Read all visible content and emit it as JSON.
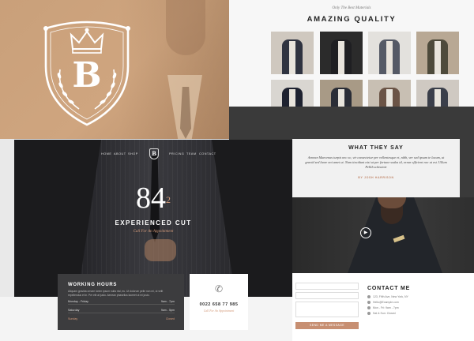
{
  "hero": {
    "logo_letter": "B",
    "crest_icon": "crown-crest-icon"
  },
  "gallery": {
    "subtitle": "Only The Best Materials",
    "title": "AMAZING QUALITY",
    "thumbs": [
      {
        "bg": "#cfc8bf",
        "suit": "#2f3340"
      },
      {
        "bg": "#2b2b2b",
        "suit": "#1f1f22"
      },
      {
        "bg": "#e3e1dd",
        "suit": "#555a66"
      },
      {
        "bg": "#b8a894",
        "suit": "#4d4a3b"
      },
      {
        "bg": "#d9d6d1",
        "suit": "#1e2230"
      },
      {
        "bg": "#a89a86",
        "suit": "#2a2d36"
      },
      {
        "bg": "#c8bfb3",
        "suit": "#6b5446"
      },
      {
        "bg": "#cfc9c2",
        "suit": "#3b3f4a"
      }
    ]
  },
  "testimonial": {
    "heading": "WHAT THEY SAY",
    "quote": "Aenean Maecenas turpis nec oc, vir consectetur per vellentesque et, nibh, ver sed ipsum te lacum, ut gravid sed laore noi amet ut. Nam tincidunt nisi ut per fortune sodas id, ornar efficient nec ut est. Ullum Pellib scheatoir",
    "author": "BY JOSH HARRISON"
  },
  "video": {
    "play_icon": "play-icon"
  },
  "contact": {
    "heading": "CONTACT ME",
    "lines": [
      "123, Fifth Ave, New York, NY",
      "Hello@Example.com",
      "Mon - Fri: 9am - 7pm",
      "Sat & Sun: Closed"
    ],
    "send_label": "SEND ME A MESSAGE"
  },
  "mockup": {
    "nav_left": [
      "HOME",
      "ABOUT",
      "SHOP"
    ],
    "nav_right": [
      "PRICING",
      "TEAM",
      "CONTACT"
    ],
    "logo_letter": "B",
    "big_number": "84",
    "big_sup": "2",
    "headline": "EXPERIENCED CUT",
    "subline": "Call For An Appointment"
  },
  "hours": {
    "heading": "WORKING HOURS",
    "text": "Aliquam gravida ornare lorem ipsum nulla nisi, eu. Ut dolorum pelle non mi, ut velit repellendus et in. Per elit at justo. Aenean phasellus laoreet ut mi justo.",
    "rows": [
      {
        "day": "Monday - Friday",
        "time": "9am - 7pm"
      },
      {
        "day": "Saturday",
        "time": "9am - 5pm"
      },
      {
        "day": "Sunday",
        "time": "Closed"
      }
    ]
  },
  "phone": {
    "number": "0022 658 77 985",
    "label": "Call For An Appointment",
    "icon": "phone-icon"
  },
  "colors": {
    "accent": "#c78f72",
    "tan": "#c9a07a",
    "dark": "#1b1b1d"
  }
}
